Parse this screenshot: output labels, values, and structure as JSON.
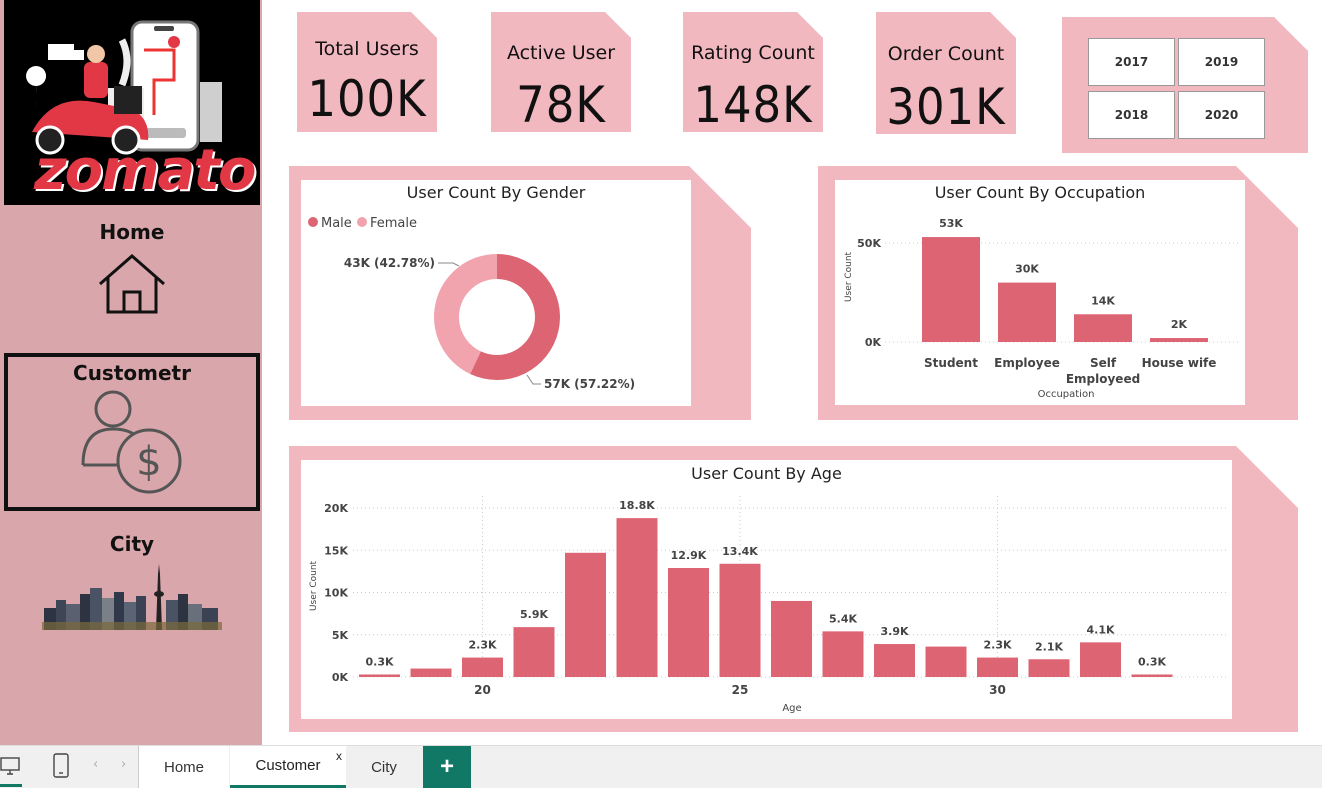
{
  "brand": {
    "name": "zomato"
  },
  "sidebar": {
    "items": [
      {
        "label": "Home",
        "icon": "house-icon"
      },
      {
        "label": "Custometr",
        "icon": "customer-dollar-icon"
      },
      {
        "label": "City",
        "icon": "city-skyline-icon"
      }
    ]
  },
  "kpis": [
    {
      "title": "Total Users",
      "value": "100K"
    },
    {
      "title": "Active User",
      "value": "78K"
    },
    {
      "title": "Rating Count",
      "value": "148K"
    },
    {
      "title": "Order Count",
      "value": "301K"
    }
  ],
  "year_slicer": {
    "years": [
      "2017",
      "2019",
      "2018",
      "2020"
    ]
  },
  "colors": {
    "accent": "#dd6472",
    "panel": "#f2b8bf",
    "sidebar": "#d9a6ab",
    "female": "#f1a3ae",
    "tab_green": "#117865"
  },
  "chart_data": [
    {
      "type": "pie",
      "title": "User Count By Gender",
      "legend": [
        "Male",
        "Female"
      ],
      "legend_position": "top-left",
      "slices": [
        {
          "name": "Male",
          "value": 57,
          "label": "57K (57.22%)"
        },
        {
          "name": "Female",
          "value": 43,
          "label": "43K (42.78%)"
        }
      ]
    },
    {
      "type": "bar",
      "title": "User Count By Occupation",
      "xlabel": "Occupation",
      "ylabel": "User Count",
      "categories": [
        "Student",
        "Employee",
        "Self Employeed",
        "House wife"
      ],
      "values": [
        53,
        30,
        14,
        2
      ],
      "data_labels": [
        "53K",
        "30K",
        "14K",
        "2K"
      ],
      "yticks": [
        "0K",
        "50K"
      ],
      "ylim": [
        0,
        60
      ]
    },
    {
      "type": "bar",
      "title": "User Count By Age",
      "xlabel": "Age",
      "ylabel": "User Count",
      "x": [
        18,
        19,
        20,
        21,
        22,
        23,
        24,
        25,
        26,
        27,
        28,
        29,
        30,
        31,
        32,
        33
      ],
      "values": [
        0.3,
        1.0,
        2.3,
        5.9,
        14.7,
        18.8,
        12.9,
        13.4,
        9.0,
        5.4,
        3.9,
        3.6,
        2.3,
        2.1,
        4.1,
        0.3
      ],
      "data_labels": [
        "0.3K",
        "",
        "2.3K",
        "5.9K",
        "",
        "18.8K",
        "12.9K",
        "13.4K",
        "",
        "5.4K",
        "3.9K",
        "",
        "2.3K",
        "2.1K",
        "4.1K",
        "0.3K"
      ],
      "xticks": [
        "20",
        "25",
        "30"
      ],
      "yticks": [
        "0K",
        "5K",
        "10K",
        "15K",
        "20K"
      ],
      "ylim": [
        0,
        21
      ],
      "grid": true
    }
  ],
  "tabs": [
    {
      "label": "Home"
    },
    {
      "label": "Customer",
      "close": "x",
      "active": true
    },
    {
      "label": "City"
    }
  ],
  "add_tab": "+"
}
